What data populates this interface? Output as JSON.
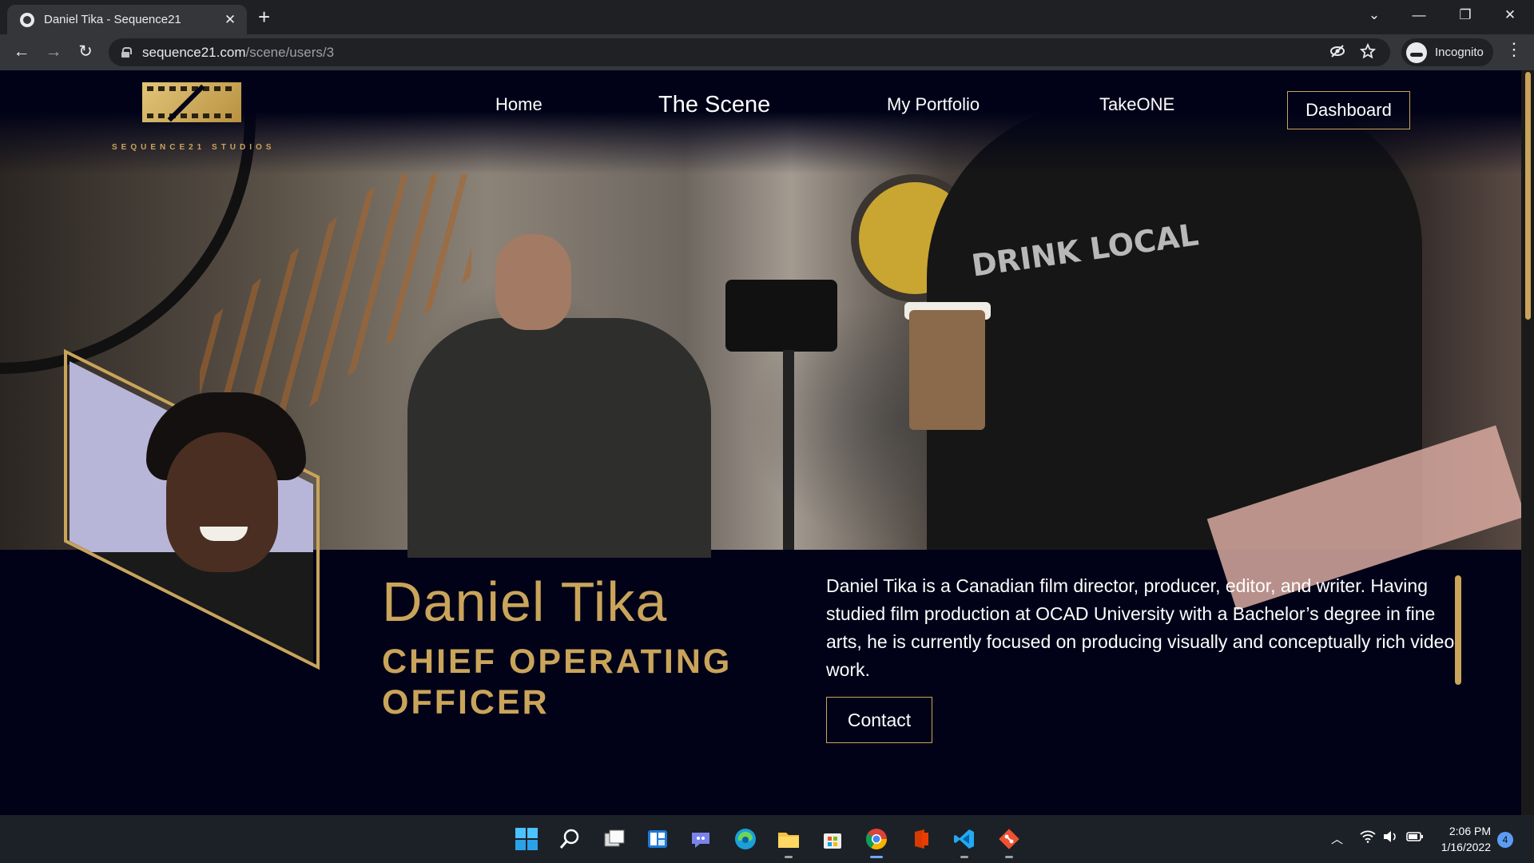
{
  "browser": {
    "tab_title": "Daniel Tika - Sequence21",
    "tab_close": "✕",
    "new_tab": "+",
    "url_host": "sequence21.com",
    "url_path": "/scene/users/3",
    "incognito_label": "Incognito",
    "window_controls": {
      "tab_search": "⌄",
      "minimize": "—",
      "restore": "❐",
      "close": "✕"
    },
    "nav": {
      "back": "←",
      "forward": "→",
      "reload": "↻"
    }
  },
  "site": {
    "logo_text": "SEQUENCE21 STUDIOS",
    "nav": {
      "home": "Home",
      "the_scene": "The Scene",
      "portfolio": "My Portfolio",
      "takeone": "TakeONE",
      "dashboard": "Dashboard"
    },
    "hero_shirt_text": "DRINK LOCAL",
    "accent_color": "#c9a45a",
    "background_color": "#010218"
  },
  "profile": {
    "name": "Daniel Tika",
    "role": "CHIEF OPERATING OFFICER",
    "bio": "Daniel Tika is a Canadian film director, producer, editor, and writer. Having studied film production at OCAD University with a Bachelor’s degree in fine arts, he is currently focused on producing visually and conceptually rich video work.",
    "contact_label": "Contact"
  },
  "taskbar": {
    "apps": [
      "windows-start",
      "search",
      "task-view",
      "widgets",
      "teams-chat",
      "edge",
      "file-explorer",
      "microsoft-store",
      "chrome",
      "office",
      "vs-code",
      "git"
    ],
    "time": "2:06 PM",
    "date": "1/16/2022",
    "notification_count": "4"
  }
}
